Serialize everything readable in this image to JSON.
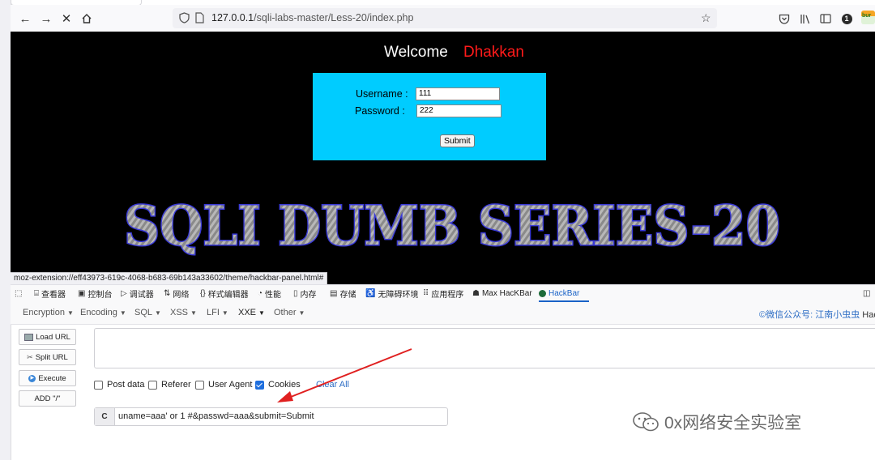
{
  "browser": {
    "url_host": "127.0.0.1",
    "url_path": "/sqli-labs-master/Less-20/index.php",
    "badge_count": "1",
    "ext_label": "bur"
  },
  "page": {
    "welcome": "Welcome",
    "welcome_name": "Dhakkan",
    "username_label": "Username :",
    "username_value": "111",
    "password_label": "Password :",
    "password_value": "222",
    "submit_label": "Submit",
    "banner_title": "SQLI DUMB SERIES-20",
    "status_url": "moz-extension://eff43973-619c-4068-b683-69b143a33602/theme/hackbar-panel.html#"
  },
  "devtools": {
    "tabs": [
      "查看器",
      "控制台",
      "调试器",
      "网络",
      "样式编辑器",
      "性能",
      "内存",
      "存储",
      "无障碍环境",
      "应用程序",
      "Max HacKBar",
      "HackBar"
    ]
  },
  "hackbar": {
    "menu": [
      "Encryption",
      "Encoding",
      "SQL",
      "XSS",
      "LFI",
      "XXE",
      "Other"
    ],
    "credit": "©微信公众号: 江南小虫虫",
    "credit_tail": "HackB",
    "buttons": {
      "load_url": "Load URL",
      "split_url": "Split URL",
      "execute": "Execute",
      "add_slash": "ADD \"/\""
    },
    "url_value": "",
    "options": {
      "post_data": "Post data",
      "referer": "Referer",
      "user_agent": "User Agent",
      "cookies": "Cookies",
      "clear_all": "Clear All"
    },
    "checked": {
      "post_data": false,
      "referer": false,
      "user_agent": false,
      "cookies": true
    },
    "post_prefix": "C",
    "post_value": "uname=aaa'  or 1 #&passwd=aaa&submit=Submit"
  },
  "watermark": "0x网络安全实验室",
  "colors": {
    "login_box": "#00ccff",
    "welcome_name": "#ff1a1a",
    "link_blue": "#2b6cc4",
    "arrow_red": "#e02020"
  }
}
